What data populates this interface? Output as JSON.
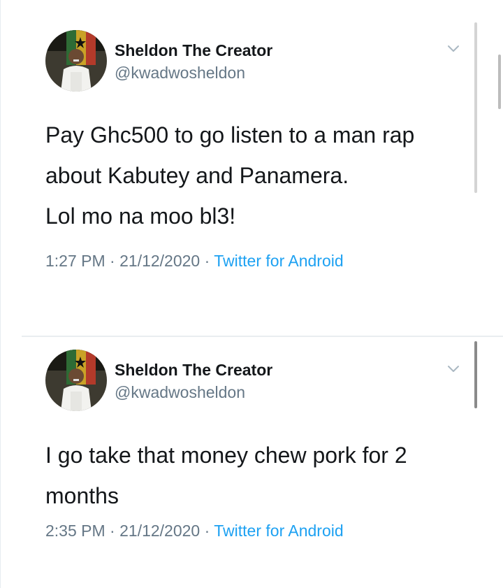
{
  "tweets": [
    {
      "display_name": "Sheldon The Creator",
      "handle": "@kwadwosheldon",
      "body_lines": [
        "Pay Ghc500 to go listen to a man rap",
        "about Kabutey and Panamera.",
        "Lol mo na moo bl3!"
      ],
      "time": "1:27 PM",
      "date": "21/12/2020",
      "separator": "·",
      "source": "Twitter for Android"
    },
    {
      "display_name": "Sheldon The Creator",
      "handle": "@kwadwosheldon",
      "body_lines": [
        "I go take that money chew pork for 2",
        "months"
      ],
      "time": "2:35 PM",
      "date": "21/12/2020",
      "separator": "·",
      "source": "Twitter for Android"
    }
  ],
  "icons": {
    "menu": "chevron-down-icon",
    "avatar": "profile-avatar"
  },
  "colors": {
    "text_primary": "#14171a",
    "text_secondary": "#657786",
    "link": "#1da1f2",
    "divider": "#e9edf0"
  }
}
